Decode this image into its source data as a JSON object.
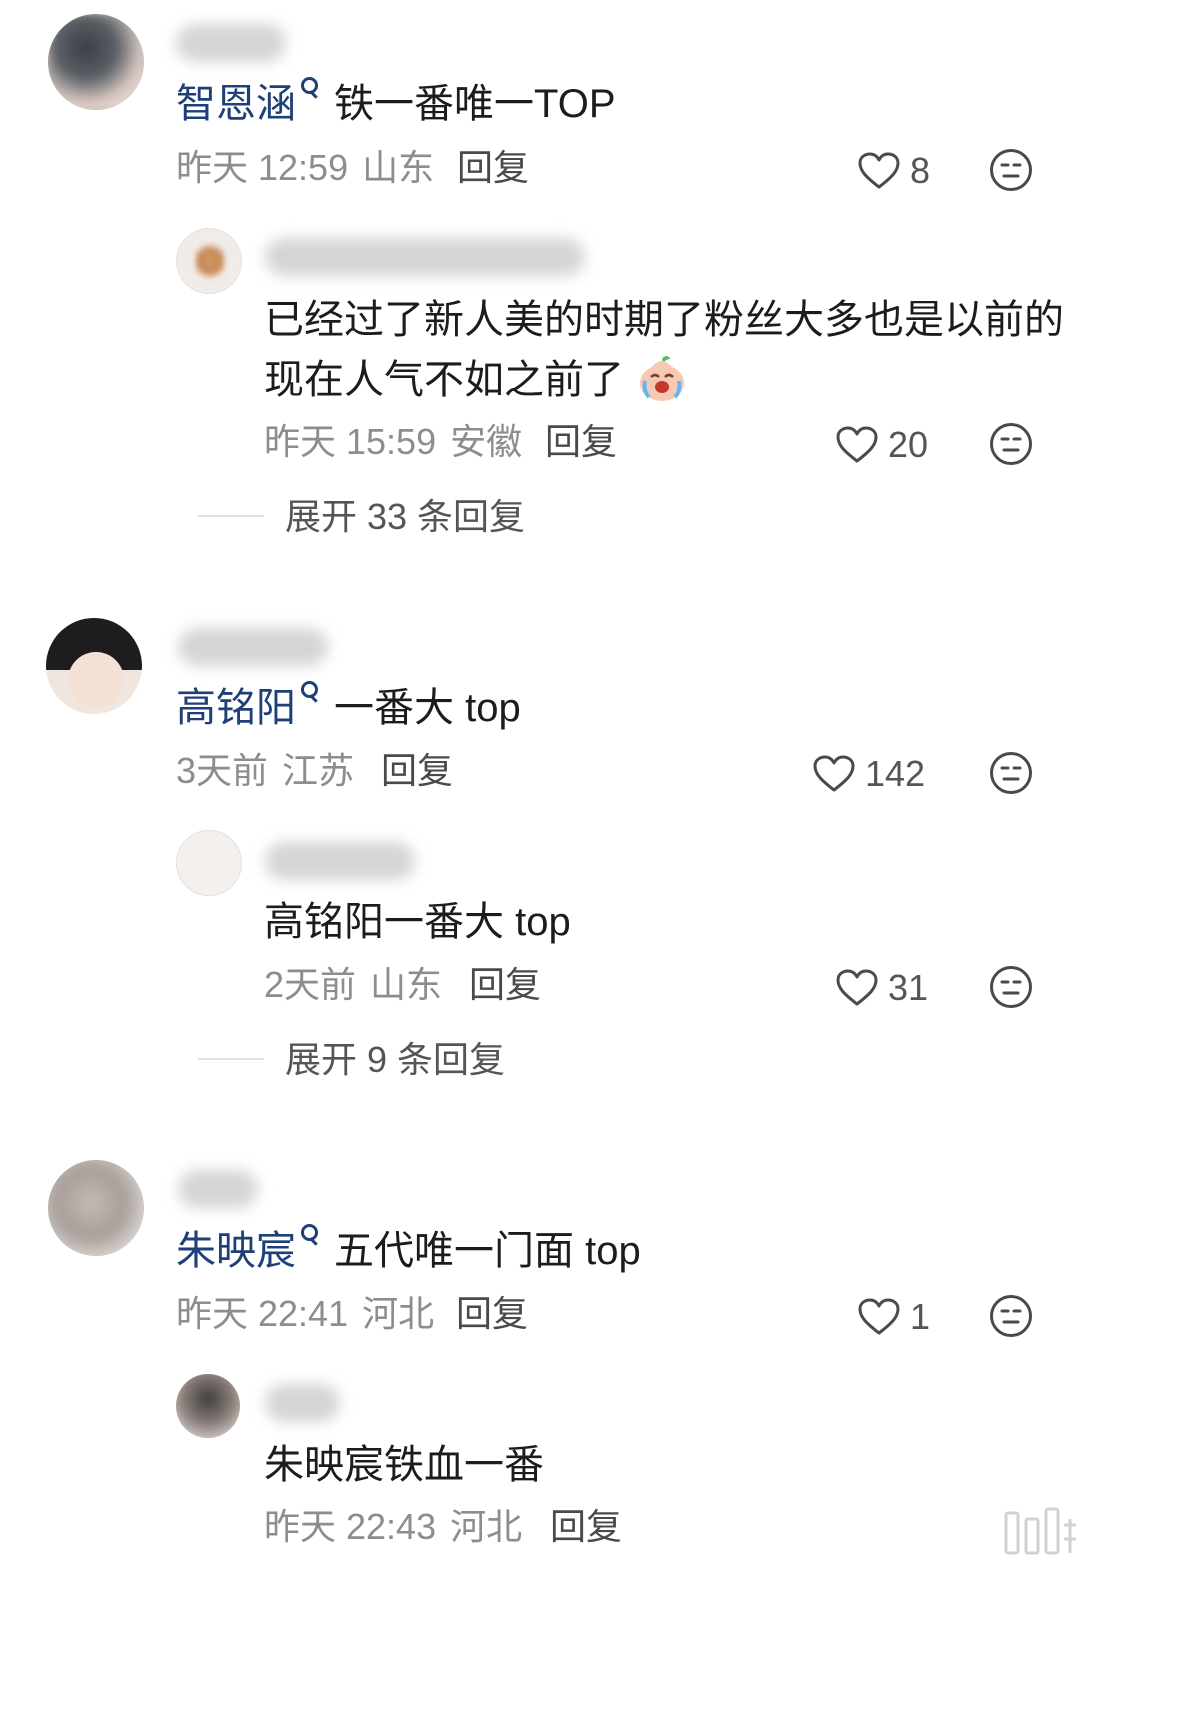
{
  "comments": [
    {
      "mention": "智恩涵",
      "text": "铁一番唯一TOP",
      "time": "昨天 12:59",
      "location": "山东",
      "reply_label": "回复",
      "likes": "8",
      "reply": {
        "text_line1": "已经过了新人美的时期了粉丝大多也是以前的",
        "text_line2": "现在人气不如之前了",
        "time": "昨天 15:59",
        "location": "安徽",
        "reply_label": "回复",
        "likes": "20"
      },
      "expand_label": "展开 33 条回复"
    },
    {
      "mention": "高铭阳",
      "text": "一番大 top",
      "time": "3天前",
      "location": "江苏",
      "reply_label": "回复",
      "likes": "142",
      "reply": {
        "text_line1": "高铭阳一番大 top",
        "time": "2天前",
        "location": "山东",
        "reply_label": "回复",
        "likes": "31"
      },
      "expand_label": "展开 9 条回复"
    },
    {
      "mention": "朱映宸",
      "text": "五代唯一门面 top",
      "time": "昨天 22:41",
      "location": "河北",
      "reply_label": "回复",
      "likes": "1",
      "reply": {
        "text_line1": "朱映宸铁血一番",
        "time": "昨天 22:43",
        "location": "河北",
        "reply_label": "回复"
      }
    }
  ],
  "emoji": {
    "crying": "crying-face-emoji"
  },
  "colors": {
    "mention": "#1e3f78",
    "meta": "#8d8d8d",
    "text": "#1c1c1c"
  }
}
